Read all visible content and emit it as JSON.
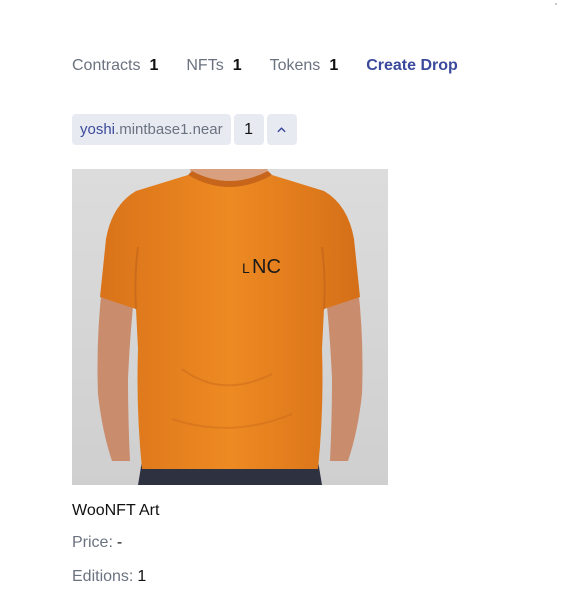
{
  "stats": [
    {
      "label": "Contracts",
      "count": "1"
    },
    {
      "label": "NFTs",
      "count": "1"
    },
    {
      "label": "Tokens",
      "count": "1"
    }
  ],
  "create_drop_label": "Create Drop",
  "contract_chip": {
    "name": "yoshi",
    "suffix": ".mintbase1.near",
    "count": "1",
    "toggle_icon": "chevron-up-icon"
  },
  "nft": {
    "image_alt": "Orange t-shirt with LNC logo",
    "logo_text": "LNC",
    "title": "WooNFT Art",
    "price_label": "Price:",
    "price_value": "-",
    "editions_label": "Editions:",
    "editions_value": "1"
  },
  "colors": {
    "accent": "#3b4a9c",
    "muted": "#6b7280",
    "chip_bg": "#e7eaf1",
    "shirt": "#e8821c"
  }
}
